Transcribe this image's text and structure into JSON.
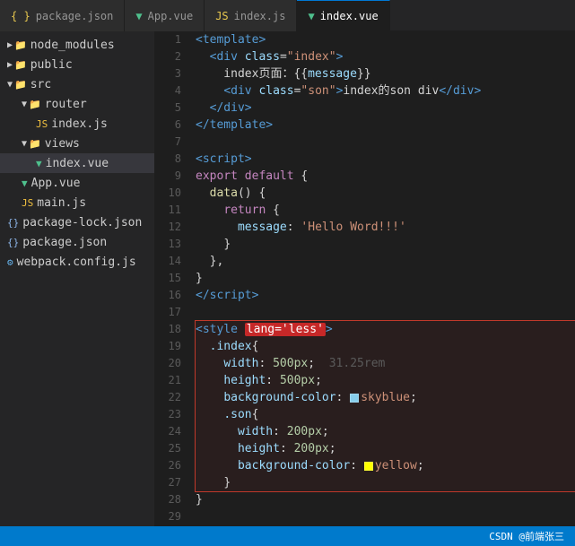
{
  "tabs": [
    {
      "id": "package-json",
      "label": "package.json",
      "icon": "json",
      "active": false
    },
    {
      "id": "app-vue",
      "label": "App.vue",
      "icon": "vue",
      "active": false
    },
    {
      "id": "index-js",
      "label": "index.js",
      "icon": "js",
      "active": false
    },
    {
      "id": "index-vue",
      "label": "index.vue",
      "icon": "vue",
      "active": true
    }
  ],
  "sidebar": {
    "items": [
      {
        "id": "node_modules",
        "label": "node_modules",
        "type": "folder",
        "indent": 0,
        "open": false
      },
      {
        "id": "public",
        "label": "public",
        "type": "folder",
        "indent": 0,
        "open": false
      },
      {
        "id": "src",
        "label": "src",
        "type": "folder",
        "indent": 0,
        "open": true
      },
      {
        "id": "router",
        "label": "router",
        "type": "folder",
        "indent": 1,
        "open": true
      },
      {
        "id": "index-js",
        "label": "index.js",
        "type": "js",
        "indent": 2,
        "active": false
      },
      {
        "id": "views",
        "label": "views",
        "type": "folder",
        "indent": 1,
        "open": true
      },
      {
        "id": "index-vue",
        "label": "index.vue",
        "type": "vue",
        "indent": 2,
        "active": true
      },
      {
        "id": "app-vue",
        "label": "App.vue",
        "type": "vue",
        "indent": 1,
        "active": false
      },
      {
        "id": "main-js",
        "label": "main.js",
        "type": "js",
        "indent": 1,
        "active": false
      },
      {
        "id": "package-lock",
        "label": "package-lock.json",
        "type": "json",
        "indent": 0
      },
      {
        "id": "package-json",
        "label": "package.json",
        "type": "json",
        "indent": 0
      },
      {
        "id": "webpack-config",
        "label": "webpack.config.js",
        "type": "webpack",
        "indent": 0
      }
    ]
  },
  "status_bar": {
    "text": "CSDN @前端张三"
  }
}
